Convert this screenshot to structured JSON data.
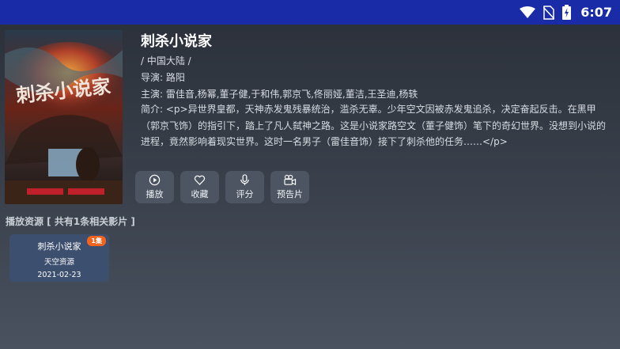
{
  "status_bar": {
    "time": "6:07",
    "icons": [
      "wifi-icon",
      "no-sim-icon",
      "battery-charging-icon"
    ]
  },
  "movie": {
    "title": "刺杀小说家",
    "region": "/ 中国大陆 /",
    "director": "导演: 路阳",
    "cast": "主演: 雷佳音,杨幂,董子健,于和伟,郭京飞,佟丽娅,董洁,王圣迪,杨轶",
    "synopsis": "简介: <p>异世界皇都，天神赤发鬼残暴统治，滥杀无辜。少年空文因被赤发鬼追杀，决定奋起反击。在黑甲（郭京飞饰）的指引下，踏上了凡人弑神之路。这是小说家路空文（董子健饰）笔下的奇幻世界。没想到小说的进程，竟然影响着现实世界。这时一名男子（雷佳音饰）接下了刺杀他的任务……</p>",
    "poster_text": "刺杀小说家"
  },
  "actions": {
    "play": "播放",
    "favorite": "收藏",
    "rate": "评分",
    "trailer": "预告片"
  },
  "sources": {
    "header": "播放资源 [ 共有1条相关影片 ]",
    "items": [
      {
        "title": "刺杀小说家",
        "source": "天空资源",
        "date": "2021-02-23",
        "badge": "1集"
      }
    ]
  },
  "colors": {
    "status_bar": "#1a2ba8",
    "button_bg": "#4d5563",
    "card_bg": "#3d4f6e",
    "badge": "#f0641e"
  }
}
